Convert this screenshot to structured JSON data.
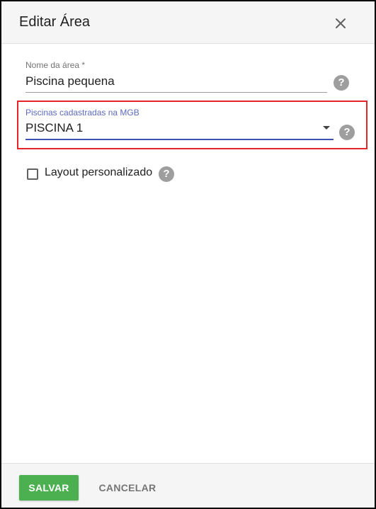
{
  "dialog": {
    "title": "Editar Área"
  },
  "fields": {
    "area_name": {
      "label": "Nome da área *",
      "value": "Piscina pequena"
    },
    "pools": {
      "label": "Piscinas cadastradas na MGB",
      "value": "PISCINA 1"
    }
  },
  "custom_layout": {
    "label": "Layout personalizado",
    "checked": false
  },
  "icons": {
    "close": "close-icon",
    "help": "help-icon",
    "dropdown": "chevron-down-icon"
  },
  "footer": {
    "save_label": "SALVAR",
    "cancel_label": "CANCELAR"
  },
  "colors": {
    "accent": "#3f51b5",
    "highlight": "#e52527",
    "save": "#4caf50"
  }
}
